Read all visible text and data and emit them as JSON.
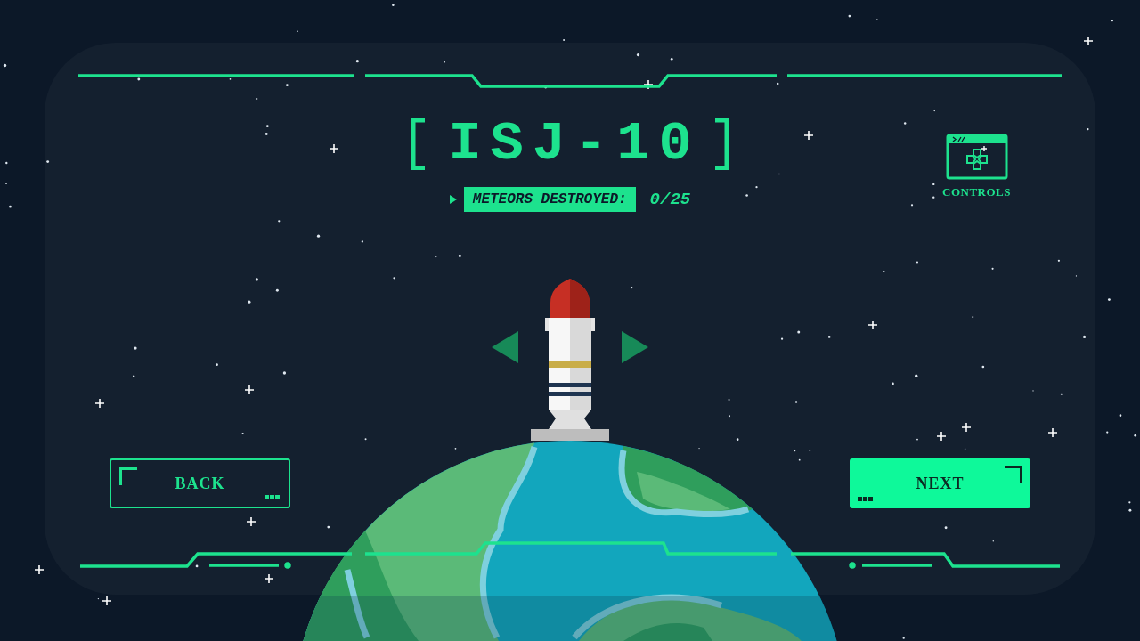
{
  "title": {
    "text": "ISJ-10"
  },
  "counter": {
    "label": "METEORS DESTROYED:",
    "value": "0/25"
  },
  "controls": {
    "label": "CONTROLS"
  },
  "buttons": [
    {
      "label": "BACK",
      "kind": "outline"
    },
    {
      "label": "NEXT",
      "kind": "filled"
    }
  ]
}
